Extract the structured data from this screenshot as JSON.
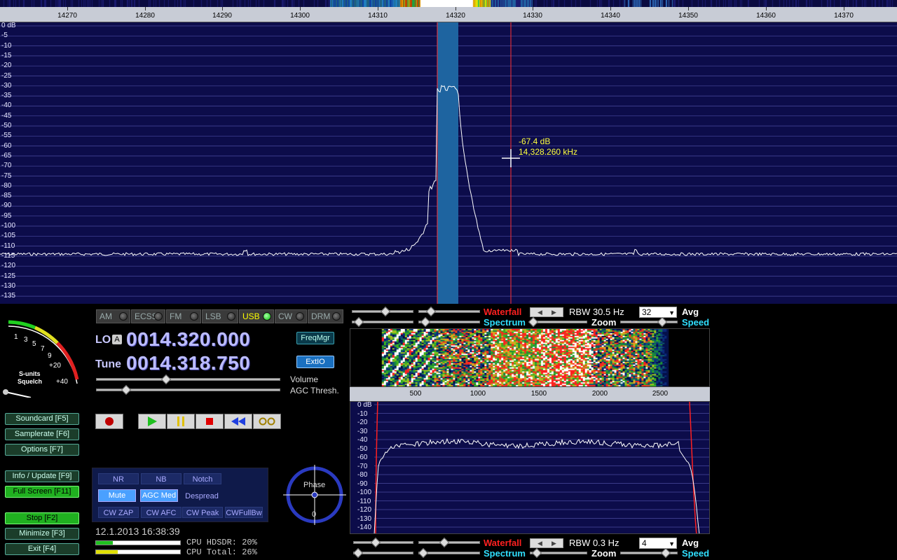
{
  "top_ruler": {
    "freq_ticks": [
      "14270",
      "14280",
      "14290",
      "14300",
      "14310",
      "14320",
      "14330",
      "14340",
      "14350",
      "14360",
      "14370"
    ]
  },
  "spectrum": {
    "db_labels": [
      "0 dB",
      "-5",
      "-10",
      "-15",
      "-20",
      "-25",
      "-30",
      "-35",
      "-40",
      "-45",
      "-50",
      "-55",
      "-60",
      "-65",
      "-70",
      "-75",
      "-80",
      "-85",
      "-90",
      "-95",
      "-100",
      "-105",
      "-110",
      "-115",
      "-120",
      "-125",
      "-130",
      "-135"
    ],
    "cursor_db": "-67.4 dB",
    "cursor_freq": "14,328.260 kHz",
    "colors": {
      "background": "#0c0c4a",
      "grid": "#4a4aa0",
      "passband": "#1e64a0",
      "marker": "#ff3030"
    }
  },
  "smeter": {
    "scale": [
      "1",
      "3",
      "5",
      "7",
      "9",
      "+20",
      "+40"
    ],
    "label_line1": "S-units",
    "label_line2": "Squelch"
  },
  "modes": [
    {
      "label": "AM",
      "active": false
    },
    {
      "label": "ECSS",
      "active": false
    },
    {
      "label": "FM",
      "active": false
    },
    {
      "label": "LSB",
      "active": false
    },
    {
      "label": "USB",
      "active": true
    },
    {
      "label": "CW",
      "active": false
    },
    {
      "label": "DRM",
      "active": false
    }
  ],
  "lo": {
    "label": "LO",
    "badge": "A",
    "value": "0014.320.000"
  },
  "tune": {
    "label": "Tune",
    "value": "0014.318.750"
  },
  "side_buttons": {
    "freqmgr": "FreqMgr",
    "extio": "ExtIO"
  },
  "sliders": {
    "volume": "Volume",
    "agc": "AGC Thresh."
  },
  "left_buttons": {
    "soundcard": "Soundcard  [F5]",
    "samplerate": "Samplerate [F6]",
    "options": "Options    [F7]",
    "info": "Info / Update  [F9]",
    "fullscreen": "Full Screen  [F11]",
    "stop": "Stop          [F2]",
    "minimize": "Minimize   [F3]",
    "exit": "Exit         [F4]"
  },
  "dsp": {
    "nr": "NR",
    "nb": "NB",
    "notch": "Notch",
    "mute": "Mute",
    "agc": "AGC Med",
    "despread": "Despread",
    "cwzap": "CW ZAP",
    "cwafc": "CW AFC",
    "cwpeak": "CW Peak",
    "cwfullbw": "CWFullBw"
  },
  "phase": {
    "label": "Phase",
    "value": "0"
  },
  "status": {
    "datetime": "12.1.2013 16:38:39",
    "cpu_hdsdr": "CPU HDSDR: 20%",
    "cpu_total": "CPU Total: 26%",
    "cpu_hdsdr_pct": 20,
    "cpu_total_pct": 26
  },
  "rf_controls": {
    "waterfall": "Waterfall",
    "spectrum": "Spectrum",
    "rbw": "RBW 30.5 Hz",
    "avg_value": "32",
    "avg": "Avg",
    "zoom": "Zoom",
    "speed": "Speed"
  },
  "audio_controls": {
    "waterfall": "Waterfall",
    "spectrum": "Spectrum",
    "rbw": "RBW  0.3 Hz",
    "avg_value": "4",
    "avg": "Avg",
    "zoom": "Zoom",
    "speed": "Speed"
  },
  "audio_axis": [
    "500",
    "1000",
    "1500",
    "2000",
    "2500"
  ],
  "audio_db_labels": [
    "0 dB",
    "-10",
    "-20",
    "-30",
    "-40",
    "-50",
    "-60",
    "-70",
    "-80",
    "-90",
    "-100",
    "-110",
    "-120",
    "-130",
    "-140"
  ]
}
